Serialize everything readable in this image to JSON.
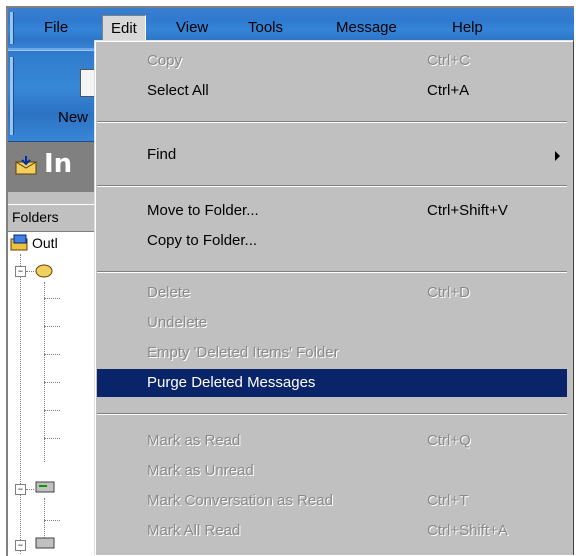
{
  "menubar": {
    "items": [
      {
        "label": "File"
      },
      {
        "label": "Edit"
      },
      {
        "label": "View"
      },
      {
        "label": "Tools"
      },
      {
        "label": "Message"
      },
      {
        "label": "Help"
      }
    ]
  },
  "toolbar": {
    "new_label": "New"
  },
  "folderbar": {
    "title": "In"
  },
  "folders": {
    "header": "Folders",
    "root_label": "Outl"
  },
  "edit_menu": {
    "items": [
      {
        "label": "Copy",
        "shortcut": "Ctrl+C",
        "disabled": true
      },
      {
        "label": "Select All",
        "shortcut": "Ctrl+A",
        "disabled": false
      },
      {
        "label": "Find",
        "shortcut": "",
        "disabled": false,
        "submenu": true
      },
      {
        "label": "Move to Folder...",
        "shortcut": "Ctrl+Shift+V",
        "disabled": false
      },
      {
        "label": "Copy to Folder...",
        "shortcut": "",
        "disabled": false
      },
      {
        "label": "Delete",
        "shortcut": "Ctrl+D",
        "disabled": true
      },
      {
        "label": "Undelete",
        "shortcut": "",
        "disabled": true
      },
      {
        "label": "Empty 'Deleted Items' Folder",
        "shortcut": "",
        "disabled": true
      },
      {
        "label": "Purge Deleted Messages",
        "shortcut": "",
        "disabled": false,
        "highlighted": true
      },
      {
        "label": "Mark as Read",
        "shortcut": "Ctrl+Q",
        "disabled": true
      },
      {
        "label": "Mark as Unread",
        "shortcut": "",
        "disabled": true
      },
      {
        "label": "Mark Conversation as Read",
        "shortcut": "Ctrl+T",
        "disabled": true
      },
      {
        "label": "Mark All Read",
        "shortcut": "Ctrl+Shift+A",
        "disabled": true
      }
    ]
  },
  "colors": {
    "menubar_bg": "#2f79cf",
    "menu_bg": "#c0c0c0",
    "highlight": "#0a246a",
    "disabled_text": "#8a8a8a"
  }
}
